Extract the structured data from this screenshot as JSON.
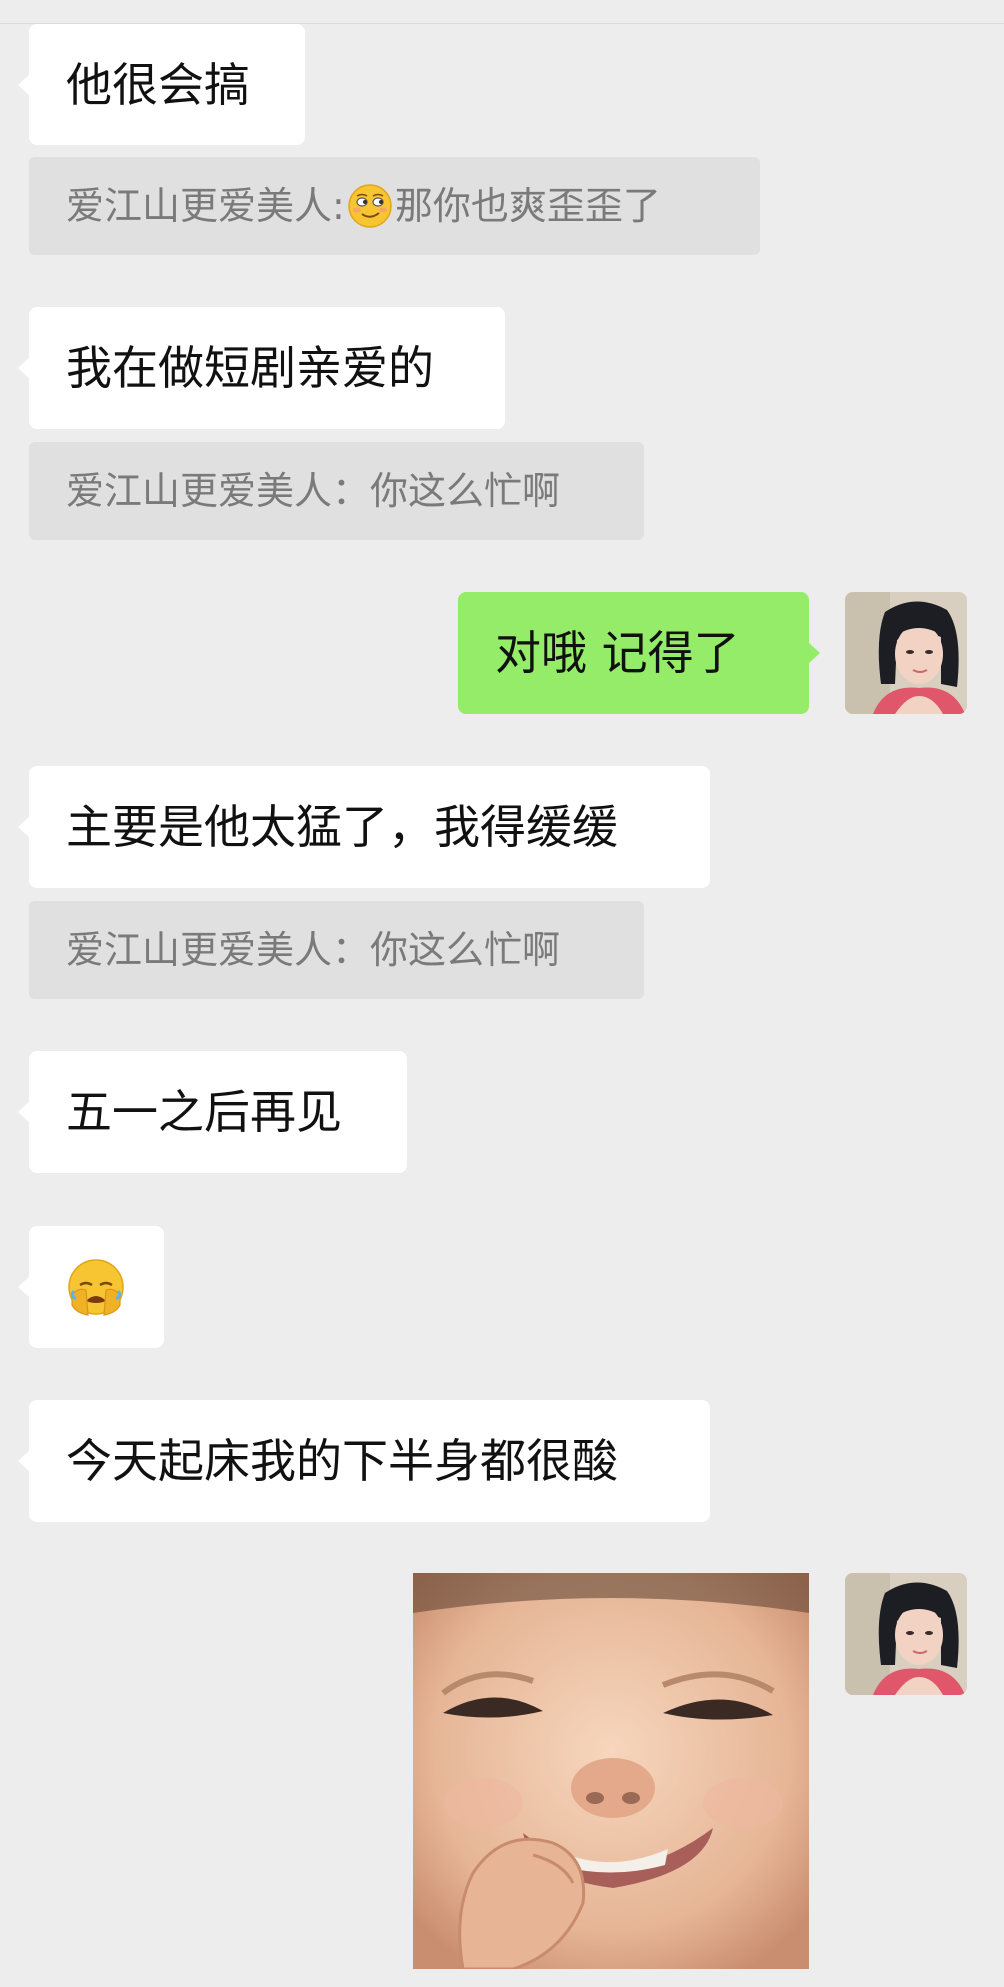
{
  "messages": [
    {
      "text": "他很会搞"
    },
    {
      "quote_name": "爱江山更爱美人:",
      "quote_text": "那你也爽歪歪了",
      "quote_emoji": "smirk-face"
    },
    {
      "text": "我在做短剧亲爱的"
    },
    {
      "quote": "爱江山更爱美人：你这么忙啊"
    },
    {
      "text": "对哦 记得了"
    },
    {
      "text": "主要是他太猛了，我得缓缓"
    },
    {
      "quote": "爱江山更爱美人：你这么忙啊"
    },
    {
      "text": "五一之后再见"
    },
    {
      "emoji": "facepalm-face"
    },
    {
      "text": "今天起床我的下半身都很酸"
    }
  ],
  "colors": {
    "background": "#ededed",
    "incoming_bubble": "#ffffff",
    "outgoing_bubble": "#95ec69",
    "quote_bg": "#e0e0e0"
  }
}
